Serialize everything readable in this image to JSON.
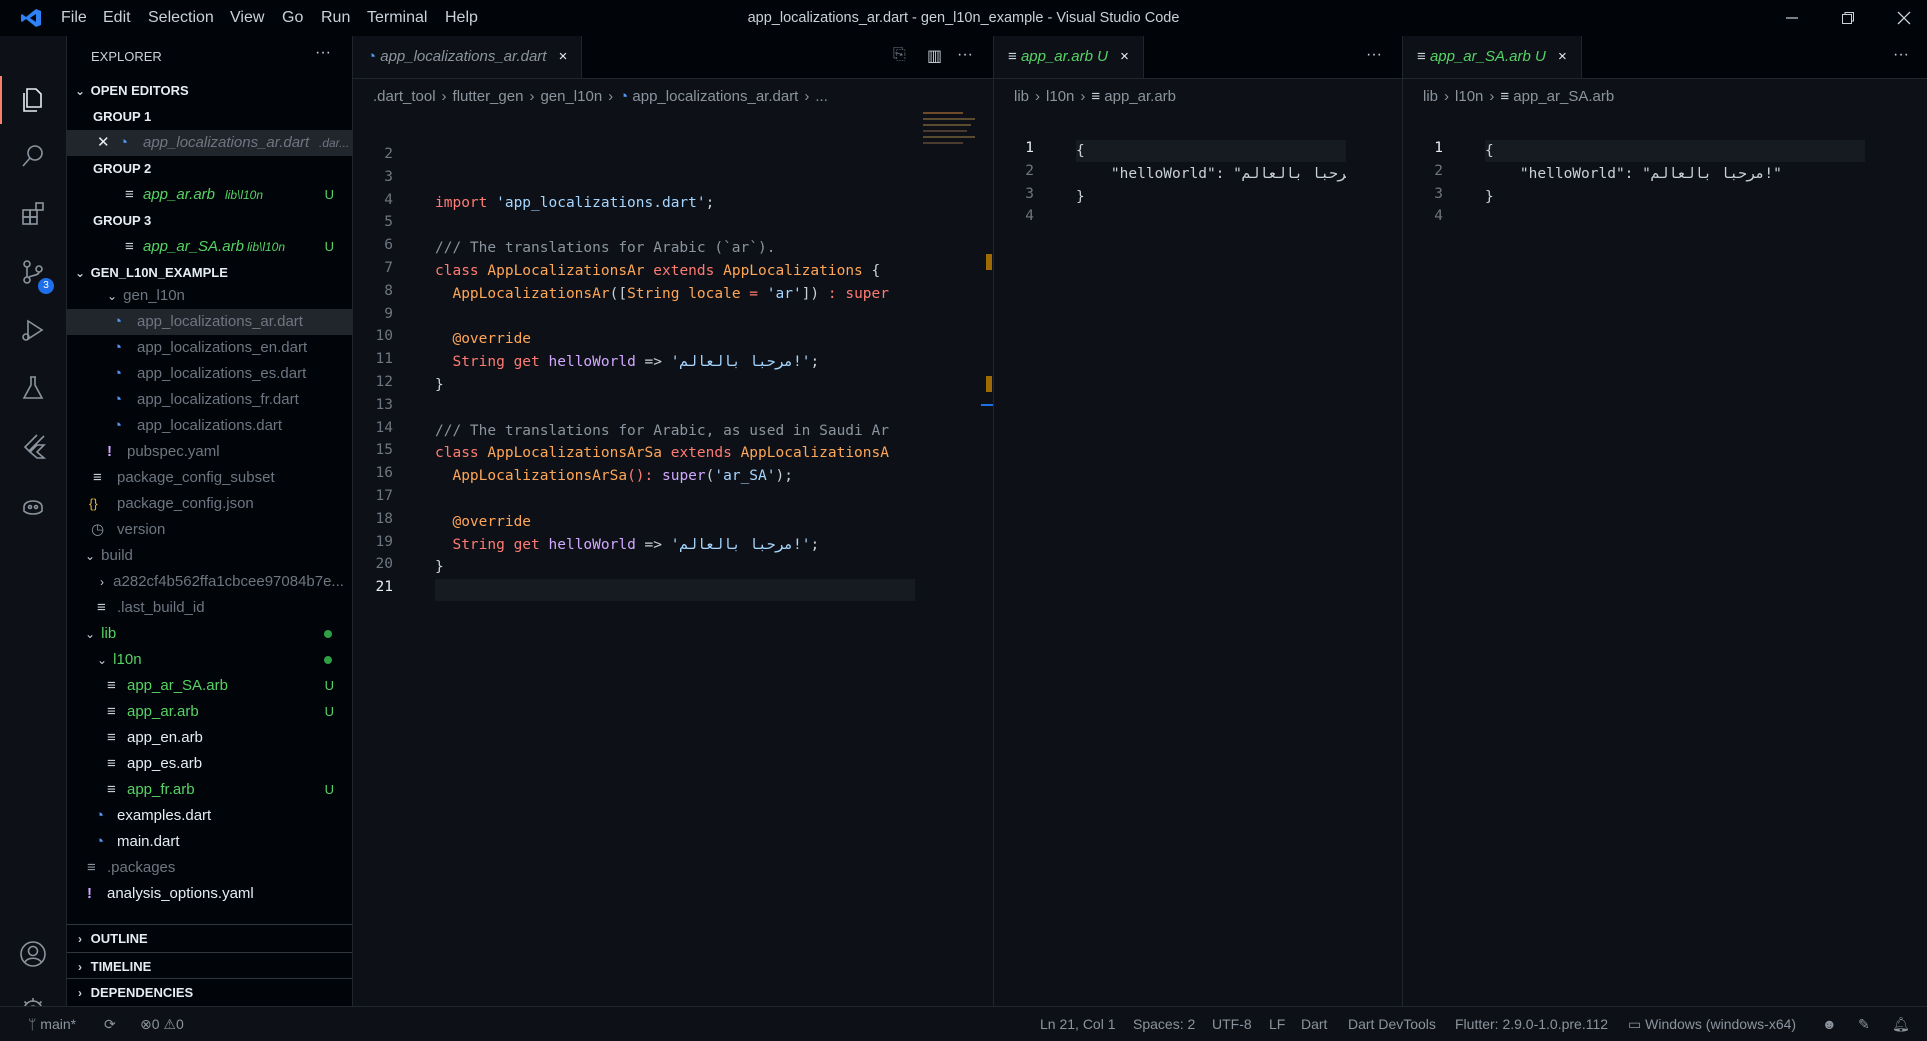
{
  "app": {
    "window_title": "app_localizations_ar.dart - gen_l10n_example - Visual Studio Code",
    "menu": [
      "File",
      "Edit",
      "Selection",
      "View",
      "Go",
      "Run",
      "Terminal",
      "Help"
    ]
  },
  "activity": {
    "scm_badge": "3"
  },
  "sidebar": {
    "title": "EXPLORER",
    "more": "···",
    "open_editors": {
      "header": "OPEN EDITORS",
      "group1": "GROUP 1",
      "group1_file": "app_localizations_ar.dart",
      "group1_path": ".dar...",
      "group2": "GROUP 2",
      "group2_file": "app_ar.arb",
      "group2_path": "lib\\l10n",
      "group2_status": "U",
      "group3": "GROUP 3",
      "group3_file": "app_ar_SA.arb",
      "group3_path": "lib\\l10n",
      "group3_status": "U"
    },
    "project": {
      "header": "GEN_L10N_EXAMPLE",
      "items": [
        {
          "label": "gen_l10n"
        },
        {
          "label": "app_localizations_ar.dart"
        },
        {
          "label": "app_localizations_en.dart"
        },
        {
          "label": "app_localizations_es.dart"
        },
        {
          "label": "app_localizations_fr.dart"
        },
        {
          "label": "app_localizations.dart"
        },
        {
          "label": "pubspec.yaml"
        },
        {
          "label": "package_config_subset"
        },
        {
          "label": "package_config.json"
        },
        {
          "label": "version"
        },
        {
          "label": "build"
        },
        {
          "label": "a282cf4b562ffa1cbcee97084b7e..."
        },
        {
          "label": ".last_build_id"
        },
        {
          "label": "lib"
        },
        {
          "label": "l10n"
        },
        {
          "label": "app_ar_SA.arb",
          "status": "U"
        },
        {
          "label": "app_ar.arb",
          "status": "U"
        },
        {
          "label": "app_en.arb"
        },
        {
          "label": "app_es.arb"
        },
        {
          "label": "app_fr.arb",
          "status": "U"
        },
        {
          "label": "examples.dart"
        },
        {
          "label": "main.dart"
        },
        {
          "label": ".packages"
        },
        {
          "label": "analysis_options.yaml"
        }
      ]
    },
    "outline": "OUTLINE",
    "timeline": "TIMELINE",
    "dependencies": "DEPENDENCIES"
  },
  "editor1": {
    "tab": "app_localizations_ar.dart",
    "close": "×",
    "breadcrumb": [
      ".dart_tool",
      "flutter_gen",
      "gen_l10n",
      "app_localizations_ar.dart",
      "..."
    ],
    "more": "···",
    "lines": [
      {
        "n": "2"
      },
      {
        "n": "3"
      },
      {
        "n": "4"
      },
      {
        "n": "5"
      },
      {
        "n": "6"
      },
      {
        "n": "7"
      },
      {
        "n": "8"
      },
      {
        "n": "9"
      },
      {
        "n": "10"
      },
      {
        "n": "11"
      },
      {
        "n": "12"
      },
      {
        "n": "13"
      },
      {
        "n": "14"
      },
      {
        "n": "15"
      },
      {
        "n": "16"
      },
      {
        "n": "17"
      },
      {
        "n": "18"
      },
      {
        "n": "19"
      },
      {
        "n": "20"
      },
      {
        "n": "21"
      }
    ],
    "code": {
      "l4a": "import ",
      "l4b": "'app_localizations.dart'",
      "l4c": ";",
      "l6": "/// The translations for Arabic (`ar`).",
      "l7a": "class ",
      "l7b": "AppLocalizationsAr ",
      "l7c": "extends ",
      "l7d": "AppLocalizations ",
      "l7e": "{",
      "l8a": "  AppLocalizationsAr",
      "l8b": "([",
      "l8c": "String ",
      "l8d": "locale ",
      "l8e": "= ",
      "l8f": "'ar'",
      "l8g": "]) ",
      "l8h": ": super",
      "l10": "  @override",
      "l11a": "  String ",
      "l11b": "get ",
      "l11c": "helloWorld ",
      "l11d": "=> ",
      "l11e": "'مرحبا بالعالم!'",
      "l11f": ";",
      "l12": "}",
      "l14": "/// The translations for Arabic, as used in Saudi Ar",
      "l15a": "class ",
      "l15b": "AppLocalizationsArSa ",
      "l15c": "extends ",
      "l15d": "AppLocalizationsA",
      "l16a": "  AppLocalizationsArSa",
      "l16b": "(): ",
      "l16c": "super",
      "l16d": "(",
      "l16e": "'ar_SA'",
      "l16f": ");",
      "l18": "  @override",
      "l19a": "  String ",
      "l19b": "get ",
      "l19c": "helloWorld ",
      "l19d": "=> ",
      "l19e": "'مرحبا بالعالم!'",
      "l19f": ";",
      "l20": "}"
    }
  },
  "editor2": {
    "tab": "app_ar.arb",
    "status": "U",
    "close": "×",
    "breadcrumb": [
      "lib",
      "l10n",
      "app_ar.arb"
    ],
    "more": "···",
    "lines": [
      {
        "n": "1"
      },
      {
        "n": "2"
      },
      {
        "n": "3"
      },
      {
        "n": "4"
      }
    ],
    "code": {
      "l1": "{",
      "l2": "    \"helloWorld\": \"مرحبا بالعالم",
      "l3": "}"
    }
  },
  "editor3": {
    "tab": "app_ar_SA.arb",
    "status": "U",
    "close": "×",
    "breadcrumb": [
      "lib",
      "l10n",
      "app_ar_SA.arb"
    ],
    "more": "···",
    "lines": [
      {
        "n": "1"
      },
      {
        "n": "2"
      },
      {
        "n": "3"
      },
      {
        "n": "4"
      }
    ],
    "code": {
      "l1": "{",
      "l2": "    \"helloWorld\": \"مرحبا بالعالم!\"",
      "l3": "}"
    }
  },
  "status": {
    "branch": "main*",
    "errors": "0",
    "warnings": "0",
    "position": "Ln 21, Col 1",
    "spaces": "Spaces: 2",
    "encoding": "UTF-8",
    "eol": "LF",
    "language": "Dart",
    "devtools": "Dart DevTools",
    "flutter": "Flutter: 2.9.0-1.0.pre.112",
    "device": "Windows (windows-x64)"
  },
  "colors": {
    "accent": "#1f6feb",
    "modified_green": "#56d364",
    "keyword": "#ff7b72",
    "string": "#a5d6ff"
  }
}
